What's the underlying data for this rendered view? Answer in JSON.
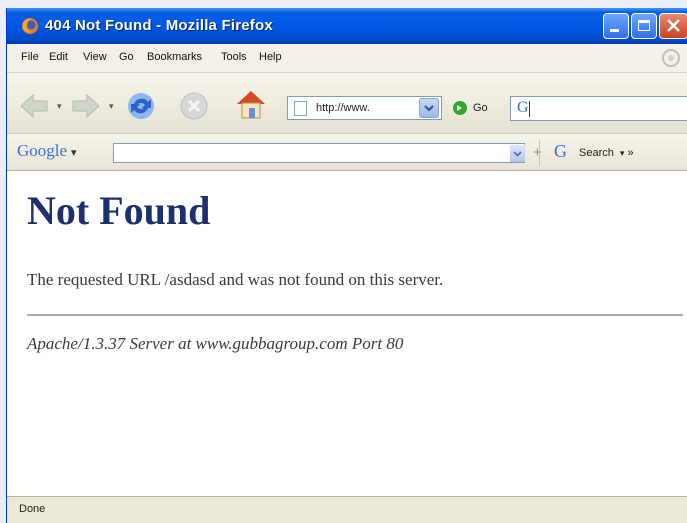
{
  "window": {
    "title": "404 Not Found - Mozilla Firefox"
  },
  "menu": {
    "items": [
      "File",
      "Edit",
      "View",
      "Go",
      "Bookmarks",
      "Tools",
      "Help"
    ]
  },
  "navbar": {
    "url": "http://www.",
    "go_label": "Go",
    "search_engine_glyph": "G"
  },
  "google_toolbar": {
    "logo": "Google",
    "search_label": "Search",
    "more": "»"
  },
  "page": {
    "heading": "Not Found",
    "message": "The requested URL /asdasd and was not found on this server.",
    "address": "Apache/1.3.37 Server at www.gubbagroup.com Port 80"
  },
  "status": {
    "text": "Done"
  },
  "colors": {
    "titlebar": "#0058e6",
    "heading": "#1c2f6e",
    "chrome": "#ece9d8"
  }
}
